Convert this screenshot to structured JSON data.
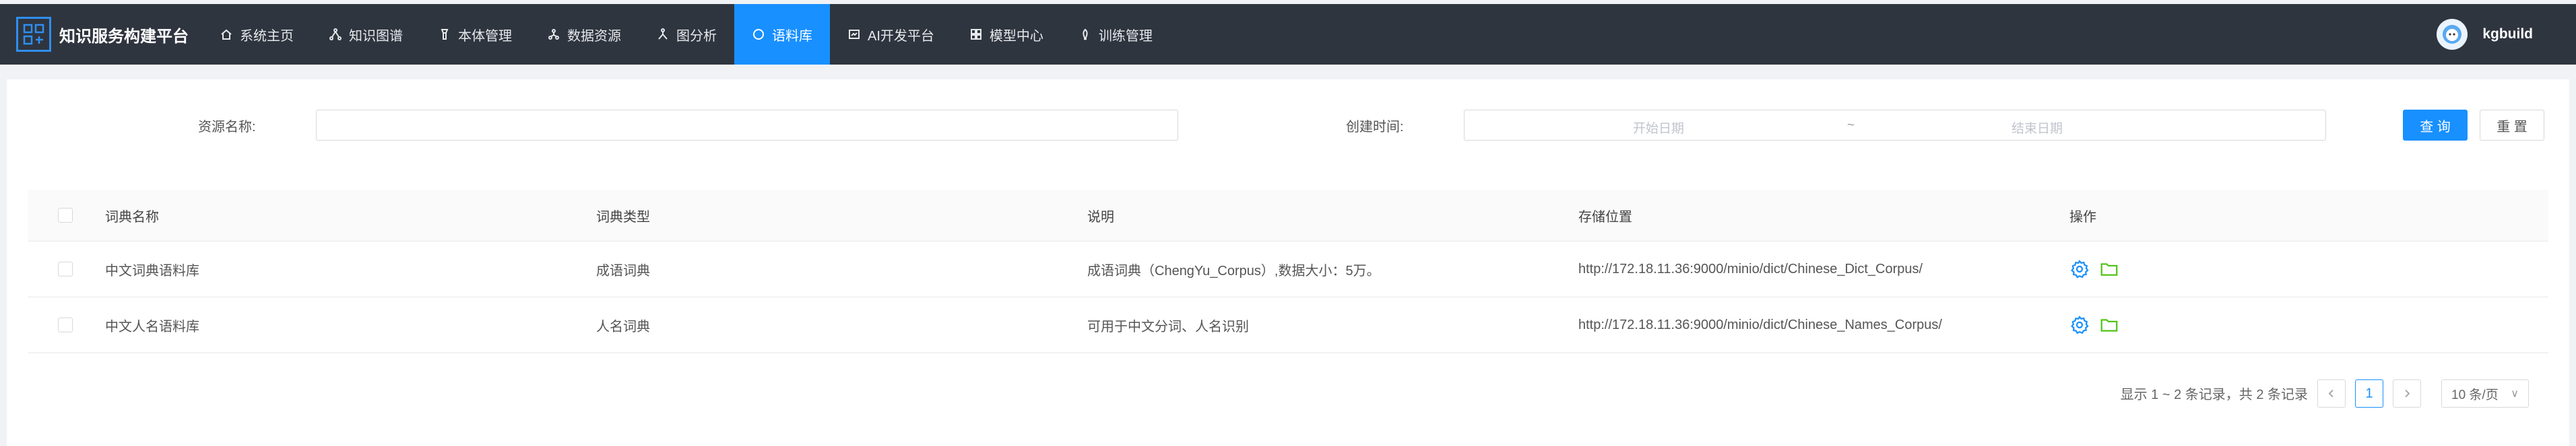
{
  "header": {
    "brand_title": "知识服务构建平台",
    "user_name": "kgbuild",
    "nav": [
      {
        "label": "系统主页",
        "icon": "home-icon",
        "active": false
      },
      {
        "label": "知识图谱",
        "icon": "graph-icon",
        "active": false
      },
      {
        "label": "本体管理",
        "icon": "ontology-icon",
        "active": false
      },
      {
        "label": "数据资源",
        "icon": "data-icon",
        "active": false
      },
      {
        "label": "图分析",
        "icon": "analysis-icon",
        "active": false
      },
      {
        "label": "语料库",
        "icon": "corpus-icon",
        "active": true
      },
      {
        "label": "AI开发平台",
        "icon": "ai-icon",
        "active": false
      },
      {
        "label": "模型中心",
        "icon": "model-icon",
        "active": false
      },
      {
        "label": "训练管理",
        "icon": "train-icon",
        "active": false
      }
    ]
  },
  "filters": {
    "resource_name_label": "资源名称:",
    "resource_name_value": "",
    "create_time_label": "创建时间:",
    "start_date_placeholder": "开始日期",
    "date_separator": "~",
    "end_date_placeholder": "结束日期",
    "search_button": "查 询",
    "reset_button": "重 置"
  },
  "table": {
    "columns": [
      "词典名称",
      "词典类型",
      "说明",
      "存储位置",
      "操作"
    ],
    "rows": [
      {
        "name": "中文词典语料库",
        "type": "成语词典",
        "desc": "成语词典（ChengYu_Corpus）,数据大小：5万。",
        "location": "http://172.18.11.36:9000/minio/dict/Chinese_Dict_Corpus/"
      },
      {
        "name": "中文人名语料库",
        "type": "人名词典",
        "desc": "可用于中文分词、人名识别",
        "location": "http://172.18.11.36:9000/minio/dict/Chinese_Names_Corpus/"
      }
    ]
  },
  "pagination": {
    "summary": "显示 1 ~ 2 条记录，共 2 条记录",
    "current_page": "1",
    "page_size": "10 条/页"
  },
  "colors": {
    "topbar": "#2f353f",
    "accent": "#1890ff",
    "folder": "#52c41a"
  }
}
